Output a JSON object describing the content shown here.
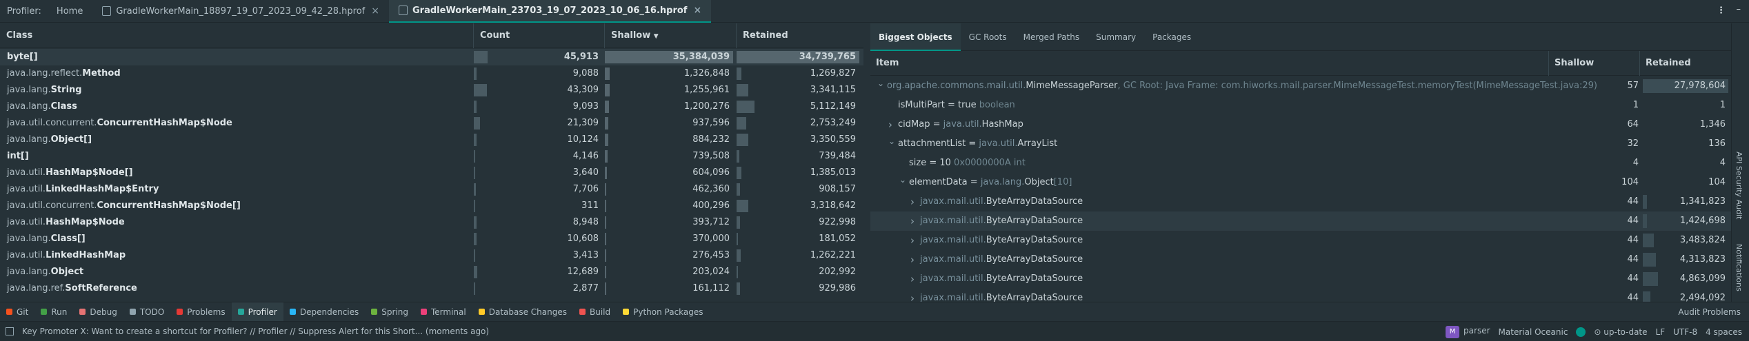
{
  "tabbar": {
    "label": "Profiler:",
    "home": "Home",
    "tabs": [
      {
        "label": "GradleWorkerMain_18897_19_07_2023_09_42_28.hprof",
        "active": false
      },
      {
        "label": "GradleWorkerMain_23703_19_07_2023_10_06_16.hprof",
        "active": true
      }
    ],
    "close_glyph": "×",
    "menu_glyph": "⋮",
    "minimize_glyph": "–"
  },
  "left_table": {
    "columns": {
      "class": "Class",
      "count": "Count",
      "shallow": "Shallow",
      "shallow_sort": "▼",
      "retained": "Retained"
    },
    "rows": [
      {
        "pkg": "",
        "name": "byte[]",
        "count": "45,913",
        "shallow": "35,384,039",
        "retained": "34,739,765",
        "count_pct": 0.106,
        "shallow_pct": 1.0,
        "retained_pct": 1.0
      },
      {
        "pkg": "java.lang.reflect.",
        "name": "Method",
        "count": "9,088",
        "shallow": "1,326,848",
        "retained": "1,269,827",
        "count_pct": 0.021,
        "shallow_pct": 0.037,
        "retained_pct": 0.037
      },
      {
        "pkg": "java.lang.",
        "name": "String",
        "count": "43,309",
        "shallow": "1,255,961",
        "retained": "3,341,115",
        "count_pct": 0.1,
        "shallow_pct": 0.035,
        "retained_pct": 0.096
      },
      {
        "pkg": "java.lang.",
        "name": "Class",
        "count": "9,093",
        "shallow": "1,200,276",
        "retained": "5,112,149",
        "count_pct": 0.021,
        "shallow_pct": 0.034,
        "retained_pct": 0.147
      },
      {
        "pkg": "java.util.concurrent.",
        "name": "ConcurrentHashMap$Node",
        "count": "21,309",
        "shallow": "937,596",
        "retained": "2,753,249",
        "count_pct": 0.049,
        "shallow_pct": 0.026,
        "retained_pct": 0.079
      },
      {
        "pkg": "java.lang.",
        "name": "Object[]",
        "count": "10,124",
        "shallow": "884,232",
        "retained": "3,350,559",
        "count_pct": 0.023,
        "shallow_pct": 0.025,
        "retained_pct": 0.096
      },
      {
        "pkg": "",
        "name": "int[]",
        "count": "4,146",
        "shallow": "739,508",
        "retained": "739,484",
        "count_pct": 0.01,
        "shallow_pct": 0.021,
        "retained_pct": 0.021
      },
      {
        "pkg": "java.util.",
        "name": "HashMap$Node[]",
        "count": "3,640",
        "shallow": "604,096",
        "retained": "1,385,013",
        "count_pct": 0.008,
        "shallow_pct": 0.017,
        "retained_pct": 0.04
      },
      {
        "pkg": "java.util.",
        "name": "LinkedHashMap$Entry",
        "count": "7,706",
        "shallow": "462,360",
        "retained": "908,157",
        "count_pct": 0.018,
        "shallow_pct": 0.013,
        "retained_pct": 0.026
      },
      {
        "pkg": "java.util.concurrent.",
        "name": "ConcurrentHashMap$Node[]",
        "count": "311",
        "shallow": "400,296",
        "retained": "3,318,642",
        "count_pct": 0.001,
        "shallow_pct": 0.011,
        "retained_pct": 0.096
      },
      {
        "pkg": "java.util.",
        "name": "HashMap$Node",
        "count": "8,948",
        "shallow": "393,712",
        "retained": "922,998",
        "count_pct": 0.021,
        "shallow_pct": 0.011,
        "retained_pct": 0.027
      },
      {
        "pkg": "java.lang.",
        "name": "Class[]",
        "count": "10,608",
        "shallow": "370,000",
        "retained": "181,052",
        "count_pct": 0.024,
        "shallow_pct": 0.01,
        "retained_pct": 0.005
      },
      {
        "pkg": "java.util.",
        "name": "LinkedHashMap",
        "count": "3,413",
        "shallow": "276,453",
        "retained": "1,262,221",
        "count_pct": 0.008,
        "shallow_pct": 0.008,
        "retained_pct": 0.036
      },
      {
        "pkg": "java.lang.",
        "name": "Object",
        "count": "12,689",
        "shallow": "203,024",
        "retained": "202,992",
        "count_pct": 0.029,
        "shallow_pct": 0.006,
        "retained_pct": 0.006
      },
      {
        "pkg": "java.lang.ref.",
        "name": "SoftReference",
        "count": "2,877",
        "shallow": "161,112",
        "retained": "929,986",
        "count_pct": 0.007,
        "shallow_pct": 0.005,
        "retained_pct": 0.027
      }
    ]
  },
  "right_panel": {
    "tabs": [
      {
        "label": "Biggest Objects",
        "active": true
      },
      {
        "label": "GC Roots",
        "active": false
      },
      {
        "label": "Merged Paths",
        "active": false
      },
      {
        "label": "Summary",
        "active": false
      },
      {
        "label": "Packages",
        "active": false
      }
    ],
    "columns": {
      "item": "Item",
      "shallow": "Shallow",
      "retained": "Retained"
    },
    "rows": [
      {
        "indent": 0,
        "arrow": "down",
        "pre": "",
        "pre_dim": "org.apache.commons.mail.util.",
        "name": "MimeMessageParser",
        "post": ", GC Root: Java Frame: com.hiworks.mail.parser.MimeMessageTest.memoryTest(MimeMessageTest.java:29)",
        "shallow": "57",
        "retained": "27,978,604",
        "retained_pct": 1.0
      },
      {
        "indent": 1,
        "arrow": "",
        "pre": "isMultiPart = true ",
        "pre_dim": "",
        "name": "",
        "post": "boolean",
        "shallow": "1",
        "retained": "1",
        "retained_pct": 0.0
      },
      {
        "indent": 1,
        "arrow": "right",
        "pre": "cidMap = ",
        "pre_dim": "java.util.",
        "name": "HashMap",
        "post": "",
        "shallow": "64",
        "retained": "1,346",
        "retained_pct": 0.0
      },
      {
        "indent": 1,
        "arrow": "down",
        "pre": "attachmentList = ",
        "pre_dim": "java.util.",
        "name": "ArrayList",
        "post": "",
        "shallow": "32",
        "retained": "136",
        "retained_pct": 0.0
      },
      {
        "indent": 2,
        "arrow": "",
        "pre": "size = 10 ",
        "pre_dim": "",
        "name": "",
        "post": "0x0000000A  int",
        "shallow": "4",
        "retained": "4",
        "retained_pct": 0.0
      },
      {
        "indent": 2,
        "arrow": "down",
        "pre": "elementData = ",
        "pre_dim": "java.lang.",
        "name": "Object",
        "post": "[10]",
        "shallow": "104",
        "retained": "104",
        "retained_pct": 0.0
      },
      {
        "indent": 3,
        "arrow": "right",
        "pre": "",
        "pre_dim": "javax.mail.util.",
        "name": "ByteArrayDataSource",
        "post": "",
        "shallow": "44",
        "retained": "1,341,823",
        "retained_pct": 0.048
      },
      {
        "indent": 3,
        "arrow": "right",
        "pre": "",
        "pre_dim": "javax.mail.util.",
        "name": "ByteArrayDataSource",
        "post": "",
        "shallow": "44",
        "retained": "1,424,698",
        "retained_pct": 0.051,
        "selected": true
      },
      {
        "indent": 3,
        "arrow": "right",
        "pre": "",
        "pre_dim": "javax.mail.util.",
        "name": "ByteArrayDataSource",
        "post": "",
        "shallow": "44",
        "retained": "3,483,824",
        "retained_pct": 0.125
      },
      {
        "indent": 3,
        "arrow": "right",
        "pre": "",
        "pre_dim": "javax.mail.util.",
        "name": "ByteArrayDataSource",
        "post": "",
        "shallow": "44",
        "retained": "4,313,823",
        "retained_pct": 0.154
      },
      {
        "indent": 3,
        "arrow": "right",
        "pre": "",
        "pre_dim": "javax.mail.util.",
        "name": "ByteArrayDataSource",
        "post": "",
        "shallow": "44",
        "retained": "4,863,099",
        "retained_pct": 0.174
      },
      {
        "indent": 3,
        "arrow": "right",
        "pre": "",
        "pre_dim": "javax.mail.util.",
        "name": "ByteArrayDataSource",
        "post": "",
        "shallow": "44",
        "retained": "2,494,092",
        "retained_pct": 0.089
      }
    ]
  },
  "side_strip": {
    "api_audit": "API Security Audit",
    "notifications": "Notifications"
  },
  "tool_windows": [
    {
      "label": "Git",
      "icon": "git-icon",
      "color": "#f4511e"
    },
    {
      "label": "Run",
      "icon": "run-icon",
      "color": "#43a047"
    },
    {
      "label": "Debug",
      "icon": "debug-icon",
      "color": "#e57373"
    },
    {
      "label": "TODO",
      "icon": "todo-icon",
      "color": "#90a4ae"
    },
    {
      "label": "Problems",
      "icon": "problems-icon",
      "color": "#e53935"
    },
    {
      "label": "Profiler",
      "icon": "profiler-icon",
      "color": "#26a69a",
      "active": true
    },
    {
      "label": "Dependencies",
      "icon": "dependencies-icon",
      "color": "#29b6f6"
    },
    {
      "label": "Spring",
      "icon": "spring-icon",
      "color": "#6db33f"
    },
    {
      "label": "Terminal",
      "icon": "terminal-icon",
      "color": "#ec407a"
    },
    {
      "label": "Database Changes",
      "icon": "database-icon",
      "color": "#ffca28"
    },
    {
      "label": "Build",
      "icon": "build-icon",
      "color": "#ef5350"
    },
    {
      "label": "Python Packages",
      "icon": "python-packages-icon",
      "color": "#fdd835"
    }
  ],
  "audit_problems": "Audit Problems",
  "status": {
    "message": "Key Promoter X: Want to create a shortcut for Profiler? // Profiler // Suppress Alert for this Short... (moments ago)",
    "badge": "M",
    "branch": "parser",
    "theme": "Material Oceanic",
    "vcs": "up-to-date",
    "line_sep": "LF",
    "encoding": "UTF-8",
    "indent": "4 spaces",
    "accent": "#009688"
  }
}
